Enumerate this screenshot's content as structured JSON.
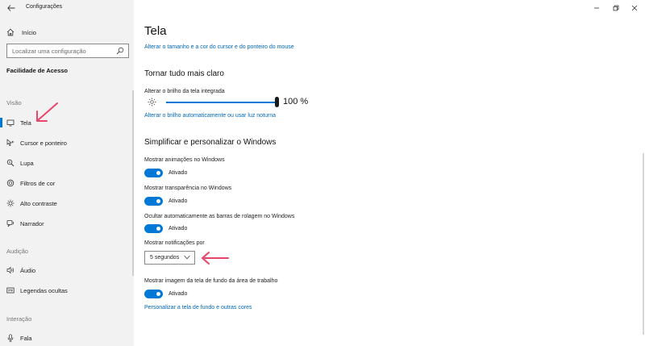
{
  "window": {
    "title": "Configurações",
    "controls": [
      "minimize-icon",
      "restore-icon",
      "close-icon"
    ]
  },
  "sidebar": {
    "home_label": "Início",
    "search_placeholder": "Localizar uma configuração",
    "section_title": "Facilidade de Acesso",
    "groups": [
      {
        "label": "Visão",
        "items": [
          {
            "label": "Tela",
            "icon": "display-icon",
            "selected": true
          },
          {
            "label": "Cursor e ponteiro",
            "icon": "cursor-icon"
          },
          {
            "label": "Lupa",
            "icon": "magnifier-icon"
          },
          {
            "label": "Filtros de cor",
            "icon": "color-filter-icon"
          },
          {
            "label": "Alto contraste",
            "icon": "contrast-icon"
          },
          {
            "label": "Narrador",
            "icon": "narrator-icon"
          }
        ]
      },
      {
        "label": "Audição",
        "items": [
          {
            "label": "Áudio",
            "icon": "speaker-icon"
          },
          {
            "label": "Legendas ocultas",
            "icon": "captions-icon"
          }
        ]
      },
      {
        "label": "Interação",
        "items": [
          {
            "label": "Fala",
            "icon": "microphone-icon"
          }
        ]
      }
    ]
  },
  "main": {
    "title": "Tela",
    "link_cursor": "Alterar o tamanho e a cor do cursor e do ponteiro do mouse",
    "brighter": {
      "heading": "Tornar tudo mais claro",
      "brightness_label": "Alterar o brilho da tela integrada",
      "brightness_value": "100 %",
      "brightness_level": 100,
      "auto_link": "Alterar o brilho automaticamente ou usar luz noturna"
    },
    "simplify": {
      "heading": "Simplificar e personalizar o Windows",
      "animations_label": "Mostrar animações no Windows",
      "animations_state": "Ativado",
      "transparency_label": "Mostrar transparência no Windows",
      "transparency_state": "Ativado",
      "scrollbars_label": "Ocultar automaticamente as barras de rolagem no Windows",
      "scrollbars_state": "Ativado",
      "notifications_label": "Mostrar notificações por",
      "notifications_value": "5 segundos",
      "background_label": "Mostrar imagem da tela de fundo da área de trabalho",
      "background_state": "Ativado",
      "personalize_link": "Personalizar a tela de fundo e outras cores"
    }
  },
  "colors": {
    "accent": "#0078d7",
    "link": "#0067b8",
    "annotation_arrow": "#e8456b",
    "sidebar_bg": "#f2f2f2"
  }
}
